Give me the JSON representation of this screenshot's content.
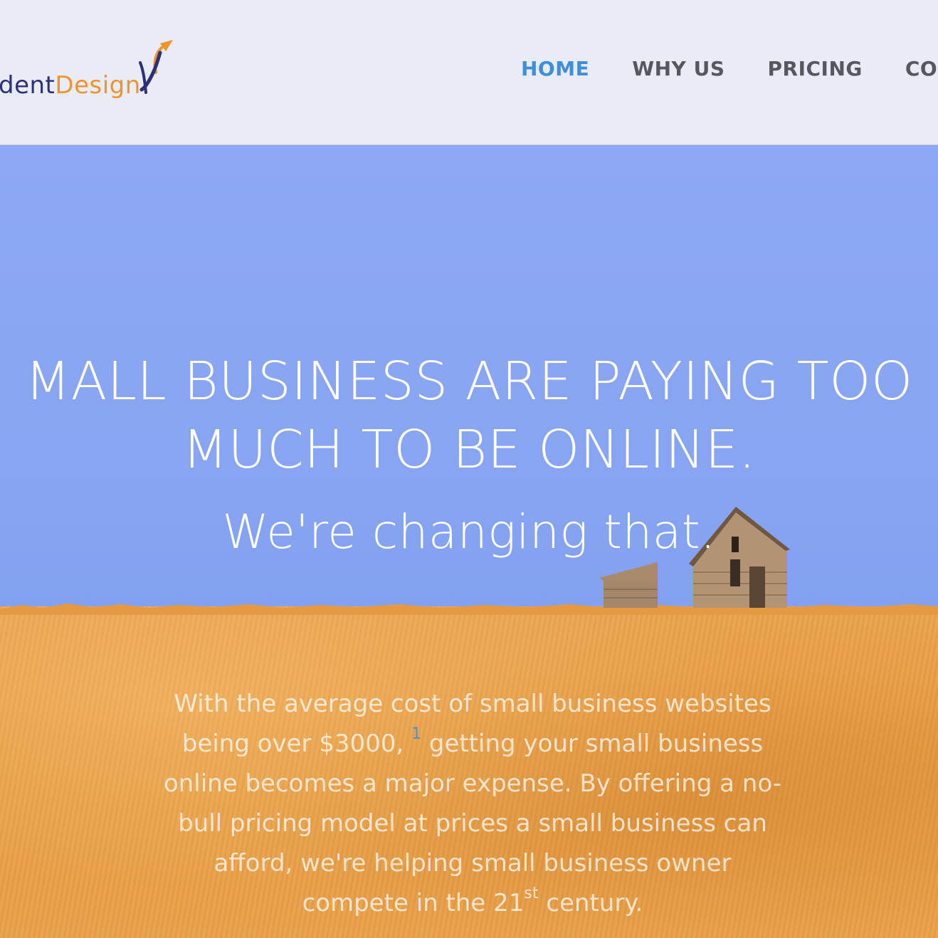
{
  "header": {
    "logo": {
      "part1": "dent",
      "part2": "Design"
    },
    "nav": [
      {
        "label": "HOME",
        "active": true
      },
      {
        "label": "WHY US",
        "active": false
      },
      {
        "label": "PRICING",
        "active": false
      },
      {
        "label": "CONT",
        "active": false
      }
    ]
  },
  "hero": {
    "headline_line1": "MALL BUSINESS ARE PAYING  TOO",
    "headline_line2": "MUCH TO BE ONLINE.",
    "subhead": "We're changing that.",
    "body": {
      "part1": "With the average cost of small business websites being over $3000,",
      "footnote": "1",
      "part2": "getting your small business online becomes a major expense.  By offering a no-bull pricing model at prices a small business can afford, we're helping small business owner compete in the 21",
      "ordinal": "st",
      "part3": "century."
    }
  },
  "colors": {
    "header_bg": "#e9ecf6",
    "nav_active": "#3f8ed9",
    "nav_default": "#55585e",
    "logo_blue": "#2c2f7a",
    "logo_orange": "#f0932b",
    "sky": "#87a4f2",
    "field": "#e59a42"
  }
}
